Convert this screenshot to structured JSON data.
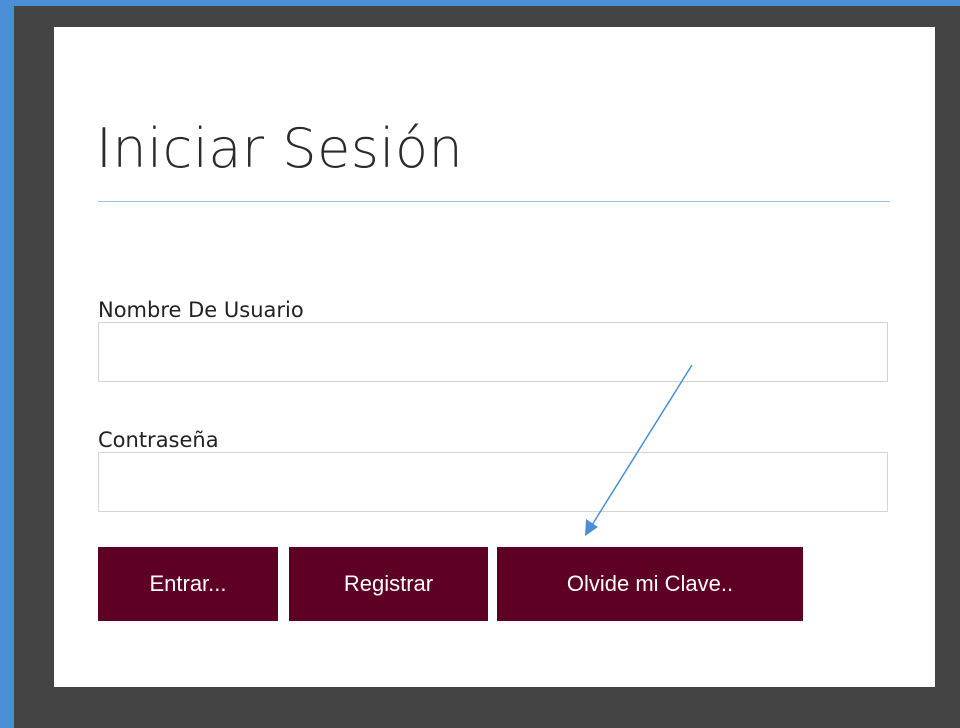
{
  "login": {
    "title": "Iniciar Sesión",
    "username_label": "Nombre De Usuario",
    "username_value": "",
    "password_label": "Contraseña",
    "password_value": "",
    "buttons": {
      "enter": "Entrar...",
      "register": "Registrar",
      "forgot": "Olvide mi Clave.."
    }
  },
  "colors": {
    "outer_background": "#4a8fd6",
    "panel_background": "#444444",
    "button_background": "#5e0024",
    "title_rule": "#9cc0e2",
    "annotation_arrow": "#4a8fd6"
  }
}
